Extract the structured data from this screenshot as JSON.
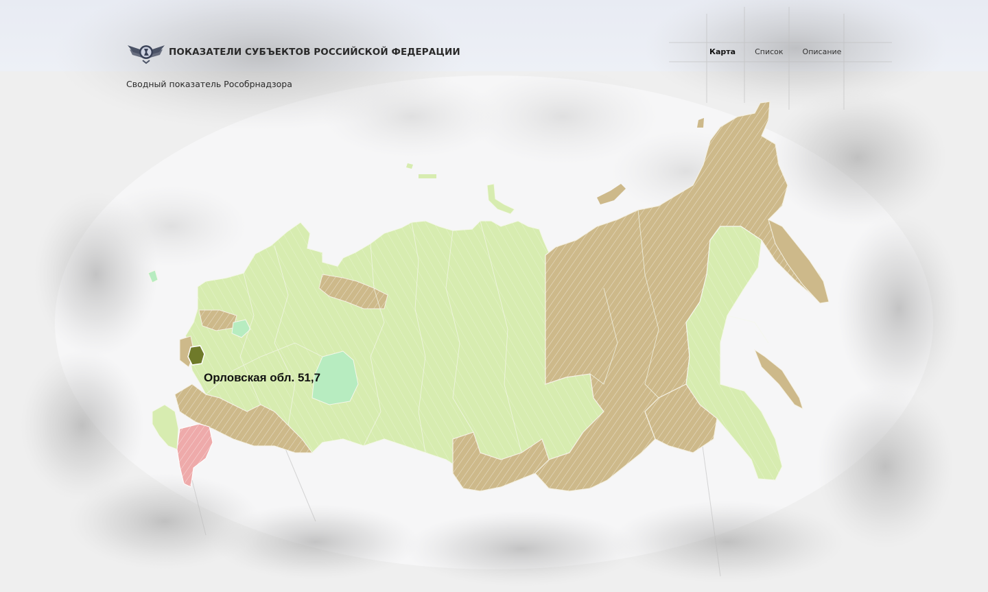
{
  "header": {
    "title": "ПОКАЗАТЕЛИ СУБЪЕКТОВ РОССИЙСКОЙ ФЕДЕРАЦИИ",
    "subtitle": "Сводный показатель Рособрнадзора",
    "logo_icon": "eagle-emblem-icon"
  },
  "nav": {
    "items": [
      {
        "label": "Карта",
        "active": true
      },
      {
        "label": "Список",
        "active": false
      },
      {
        "label": "Описание",
        "active": false
      }
    ]
  },
  "map": {
    "hover_region": "Орловская обл.",
    "hover_value": "51,7",
    "hover_label": "Орловская обл. 51,7",
    "colors": {
      "light_green": "#d7ecb0",
      "tan": "#cdb98a",
      "pink": "#eeaaaa",
      "mint": "#b7ecc0",
      "dark_green": "#6f7a2a"
    }
  }
}
